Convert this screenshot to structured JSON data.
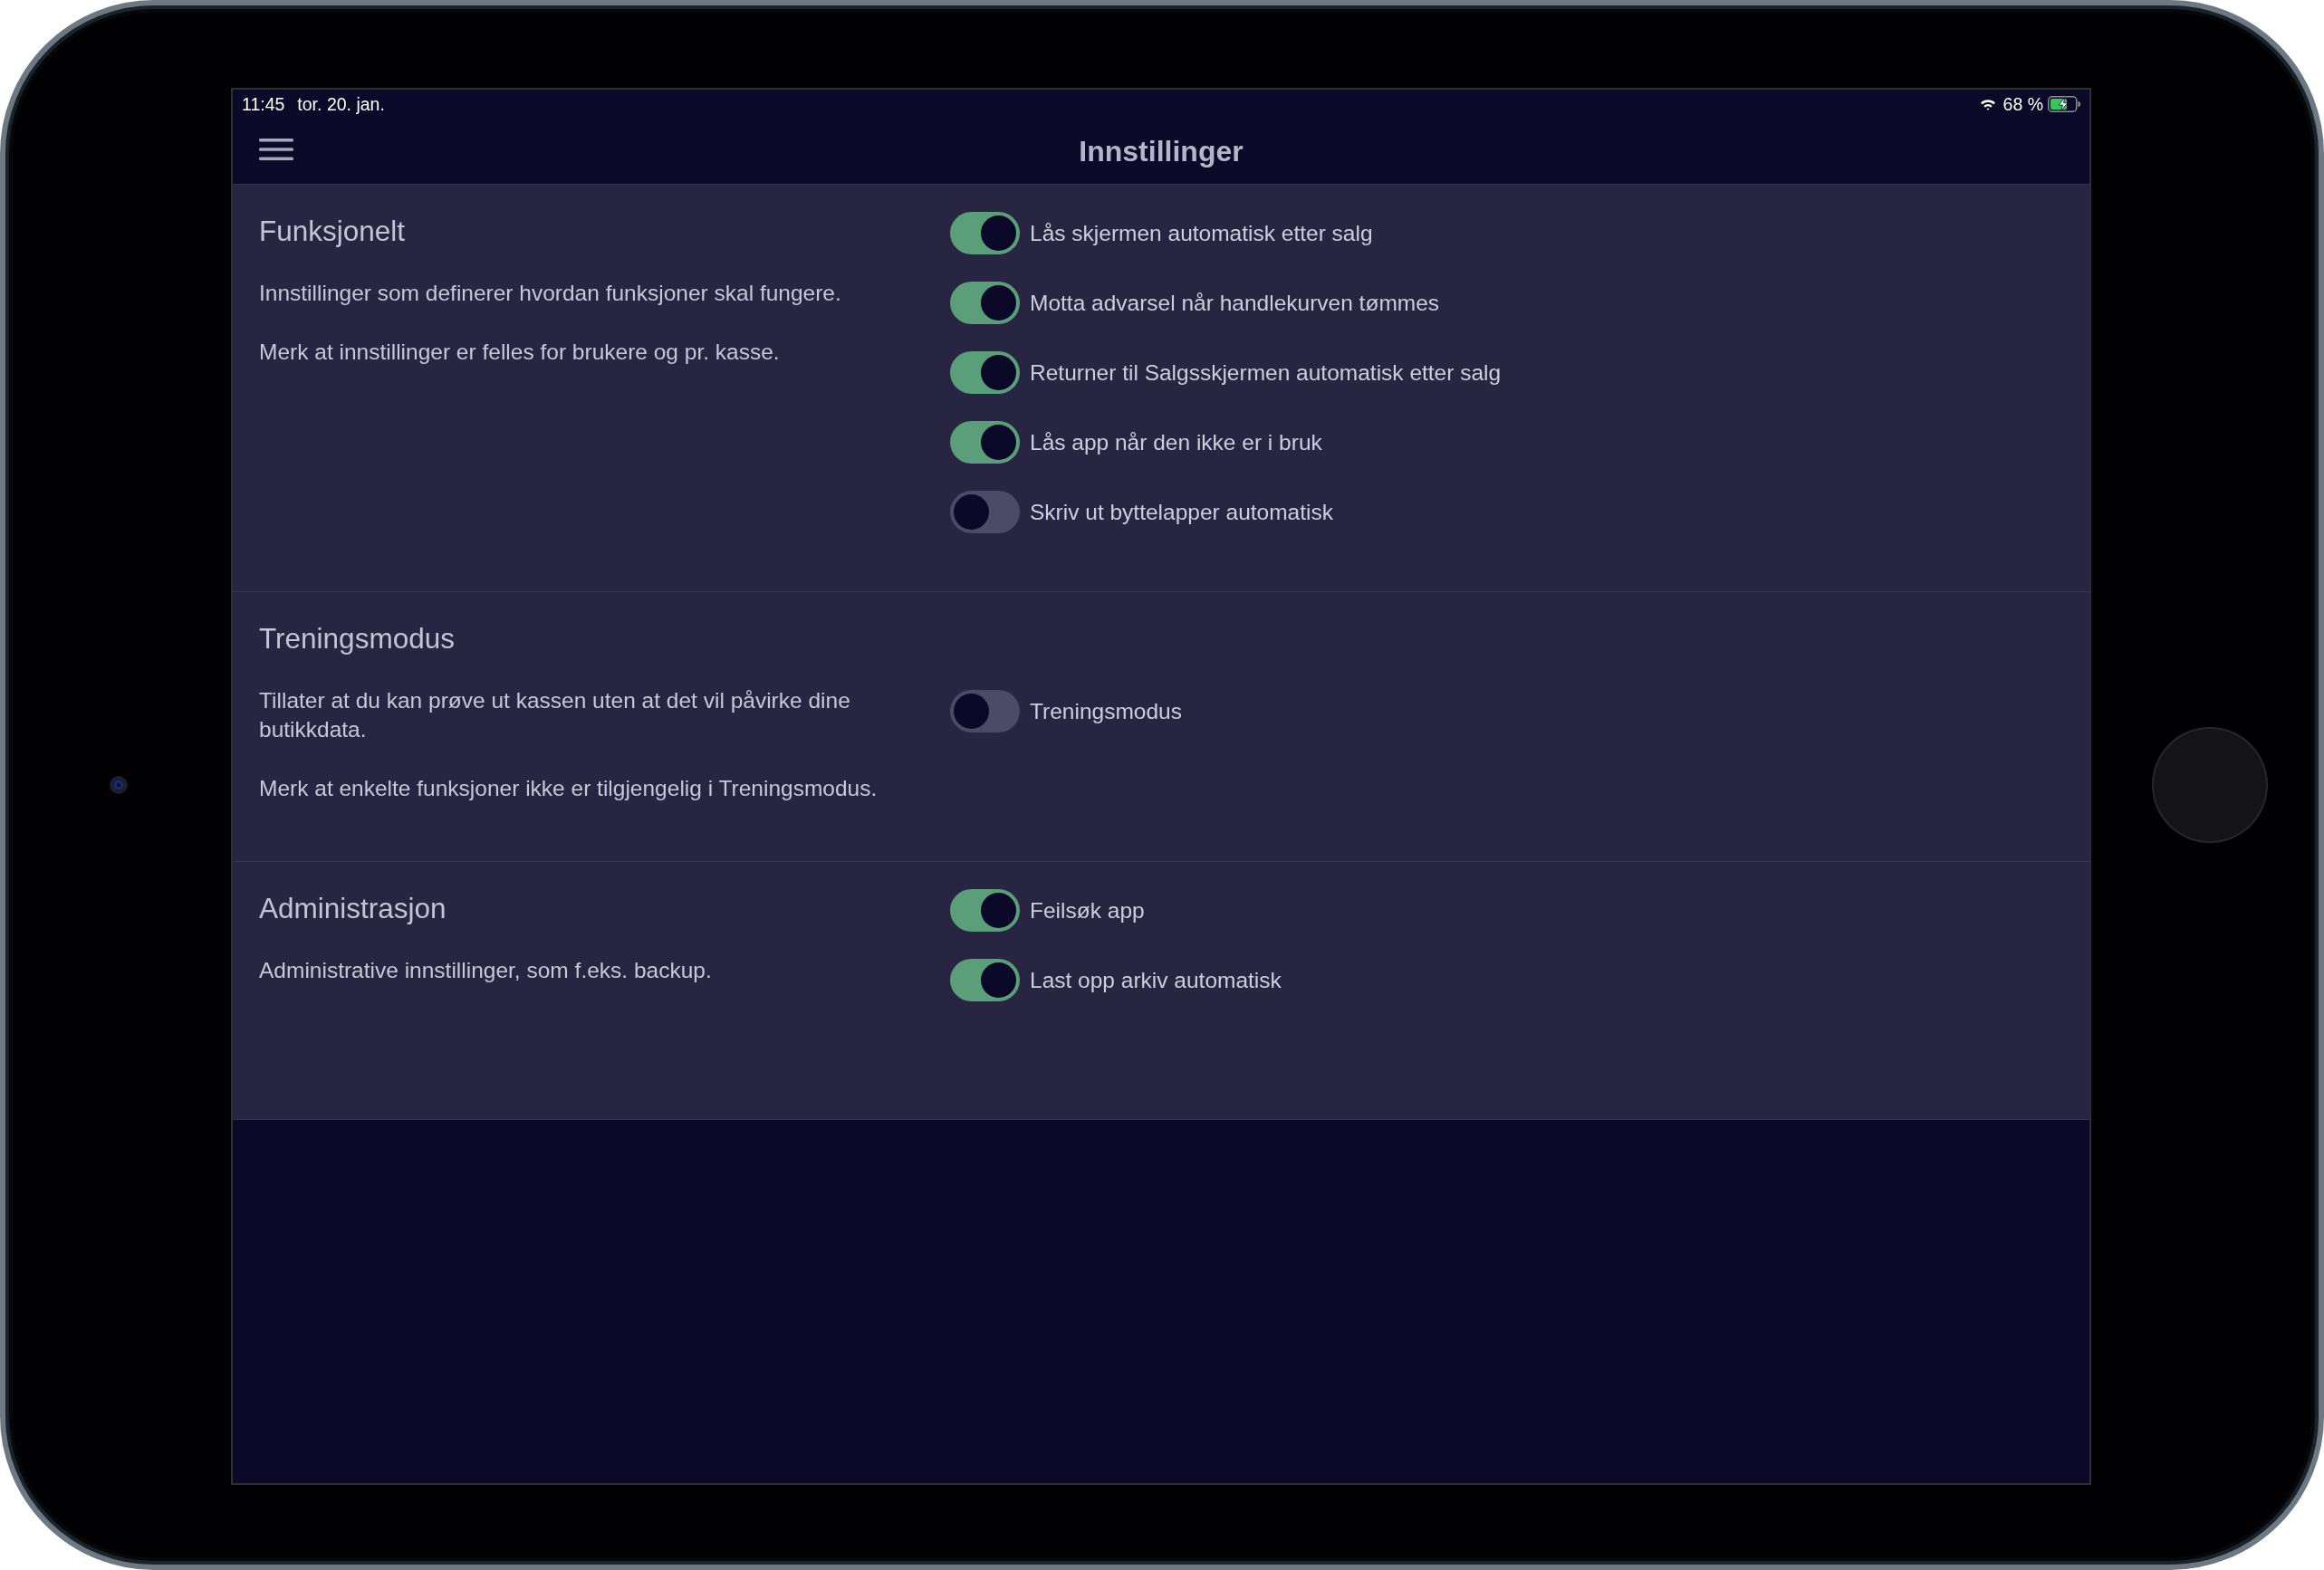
{
  "status_bar": {
    "time": "11:45",
    "date": "tor. 20. jan.",
    "battery_text": "68 %"
  },
  "header": {
    "title": "Innstillinger"
  },
  "sections": [
    {
      "title": "Funksjonelt",
      "paragraphs": [
        "Innstillinger som definerer hvordan funksjoner skal fungere.",
        "Merk at innstillinger er felles for brukere og pr. kasse."
      ],
      "toggles": [
        {
          "label": "Lås skjermen automatisk etter salg",
          "on": true
        },
        {
          "label": "Motta advarsel når handlekurven tømmes",
          "on": true
        },
        {
          "label": "Returner til Salgsskjermen automatisk etter salg",
          "on": true
        },
        {
          "label": "Lås app når den ikke er i bruk",
          "on": true
        },
        {
          "label": "Skriv ut byttelapper automatisk",
          "on": false
        }
      ]
    },
    {
      "title": "Treningsmodus",
      "paragraphs": [
        "Tillater at du kan prøve ut kassen uten at det vil påvirke dine butikkdata.",
        "Merk at enkelte funksjoner ikke er tilgjengelig i Treningsmodus."
      ],
      "toggles": [
        {
          "label": "Treningsmodus",
          "on": false
        }
      ]
    },
    {
      "title": "Administrasjon",
      "paragraphs": [
        "Administrative innstillinger, som f.eks. backup."
      ],
      "toggles": [
        {
          "label": "Feilsøk app",
          "on": true
        },
        {
          "label": "Last opp arkiv automatisk",
          "on": true
        }
      ]
    }
  ]
}
